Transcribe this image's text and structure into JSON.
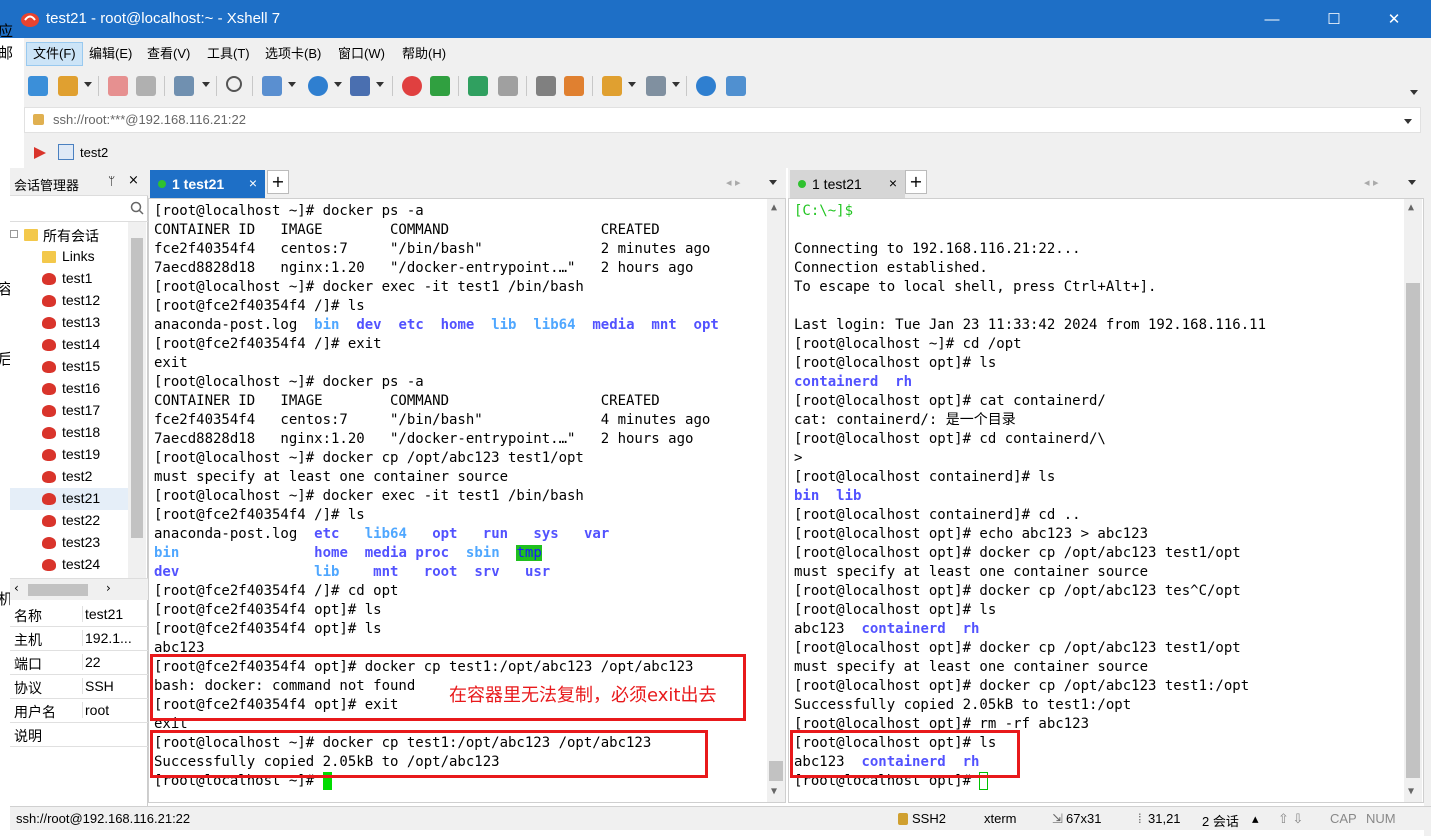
{
  "window": {
    "title": "test21 - root@localhost:~ - Xshell 7",
    "controls": {
      "minimize": "—",
      "maximize": "☐",
      "close": "✕"
    }
  },
  "menu": [
    "文件(F)",
    "编辑(E)",
    "查看(V)",
    "工具(T)",
    "选项卡(B)",
    "窗口(W)",
    "帮助(H)"
  ],
  "address": {
    "value": "ssh://root:***@192.168.116.21:22"
  },
  "quickbar": {
    "label": "test2"
  },
  "session_manager": {
    "title": "会话管理器",
    "pin": "ᛘ",
    "close": "×",
    "root": "所有会话",
    "folder": "Links",
    "sessions": [
      "test1",
      "test12",
      "test13",
      "test14",
      "test15",
      "test16",
      "test17",
      "test18",
      "test19",
      "test2",
      "test21",
      "test22",
      "test23",
      "test24"
    ],
    "selected": "test21",
    "properties": [
      {
        "key": "名称",
        "value": "test21"
      },
      {
        "key": "主机",
        "value": "192.1..."
      },
      {
        "key": "端口",
        "value": "22"
      },
      {
        "key": "协议",
        "value": "SSH"
      },
      {
        "key": "用户名",
        "value": "root"
      },
      {
        "key": "说明",
        "value": ""
      }
    ]
  },
  "left_tab": {
    "label": "1 test21",
    "close": "×",
    "plus": "+"
  },
  "right_tab": {
    "label": "1 test21",
    "close": "×",
    "plus": "+"
  },
  "left_terminal": {
    "lines": [
      "[root@localhost ~]# docker ps -a",
      "CONTAINER ID   IMAGE        COMMAND                  CREATED",
      "fce2f40354f4   centos:7     \"/bin/bash\"              2 minutes ago",
      "7aecd8828d18   nginx:1.20   \"/docker-entrypoint.…\"   2 hours ago",
      "[root@localhost ~]# docker exec -it test1 /bin/bash",
      "[root@fce2f40354f4 /]# ls",
      "anaconda-post.log  ",
      "[root@fce2f40354f4 /]# exit",
      "exit",
      "[root@localhost ~]# docker ps -a",
      "CONTAINER ID   IMAGE        COMMAND                  CREATED",
      "fce2f40354f4   centos:7     \"/bin/bash\"              4 minutes ago",
      "7aecd8828d18   nginx:1.20   \"/docker-entrypoint.…\"   2 hours ago",
      "[root@localhost ~]# docker cp /opt/abc123 test1/opt",
      "must specify at least one container source",
      "[root@localhost ~]# docker exec -it test1 /bin/bash",
      "[root@fce2f40354f4 /]# ls",
      "anaconda-post.log  ",
      "",
      "",
      "[root@fce2f40354f4 /]# cd opt",
      "[root@fce2f40354f4 opt]# ls",
      "[root@fce2f40354f4 opt]# ls",
      "abc123",
      "[root@fce2f40354f4 opt]# docker cp test1:/opt/abc123 /opt/abc123",
      "bash: docker: command not found",
      "[root@fce2f40354f4 opt]# exit",
      "exit",
      "[root@localhost ~]# docker cp test1:/opt/abc123 /opt/abc123",
      "Successfully copied 2.05kB to /opt/abc123",
      "[root@localhost ~]# "
    ],
    "ls1": [
      "bin",
      "dev",
      "etc",
      "home",
      "lib",
      "lib64",
      "media",
      "mnt",
      "opt"
    ],
    "ls2": {
      "row1": [
        "etc",
        "lib64",
        "opt",
        "run",
        "sys",
        "var"
      ],
      "row2": [
        "bin",
        "home",
        "media",
        "proc",
        "sbin",
        "tmp"
      ],
      "row3": [
        "dev",
        "lib",
        "mnt",
        "root",
        "srv",
        "usr"
      ]
    },
    "annotation": "在容器里无法复制，必须exit出去"
  },
  "right_terminal": {
    "prompt": "[C:\\~]$",
    "lines": [
      "",
      "Connecting to 192.168.116.21:22...",
      "Connection established.",
      "To escape to local shell, press Ctrl+Alt+].",
      "",
      "Last login: Tue Jan 23 11:33:42 2024 from 192.168.116.11",
      "[root@localhost ~]# cd /opt",
      "[root@localhost opt]# ls",
      "",
      "[root@localhost opt]# cat containerd/",
      "cat: containerd/: 是一个目录",
      "[root@localhost opt]# cd containerd/\\",
      ">",
      "[root@localhost containerd]# ls",
      "",
      "[root@localhost containerd]# cd ..",
      "[root@localhost opt]# echo abc123 > abc123",
      "[root@localhost opt]# docker cp /opt/abc123 test1/opt",
      "must specify at least one container source",
      "[root@localhost opt]# docker cp /opt/abc123 tes^C/opt",
      "[root@localhost opt]# ls",
      "abc123  ",
      "[root@localhost opt]# docker cp /opt/abc123 test1/opt",
      "must specify at least one container source",
      "[root@localhost opt]# docker cp /opt/abc123 test1:/opt",
      "Successfully copied 2.05kB to test1:/opt",
      "[root@localhost opt]# rm -rf abc123",
      "[root@localhost opt]# ls",
      "abc123  ",
      "[root@localhost opt]# "
    ],
    "ls_a": [
      "containerd",
      "rh"
    ],
    "ls_b": [
      "bin",
      "lib"
    ]
  },
  "statusbar": {
    "conn": "ssh://root@192.168.116.21:22",
    "proto": "SSH2",
    "term": "xterm",
    "size": "67x31",
    "pos": "31,21",
    "sessions": "2 会话",
    "cap": "CAP",
    "num": "NUM"
  },
  "colors": {
    "titlebar": "#1e6fc6",
    "dir_blue": "#5252ff",
    "dir_cyan": "#4fa7ff",
    "annotation_red": "#e8191b",
    "cursor_green": "#00dc00"
  }
}
